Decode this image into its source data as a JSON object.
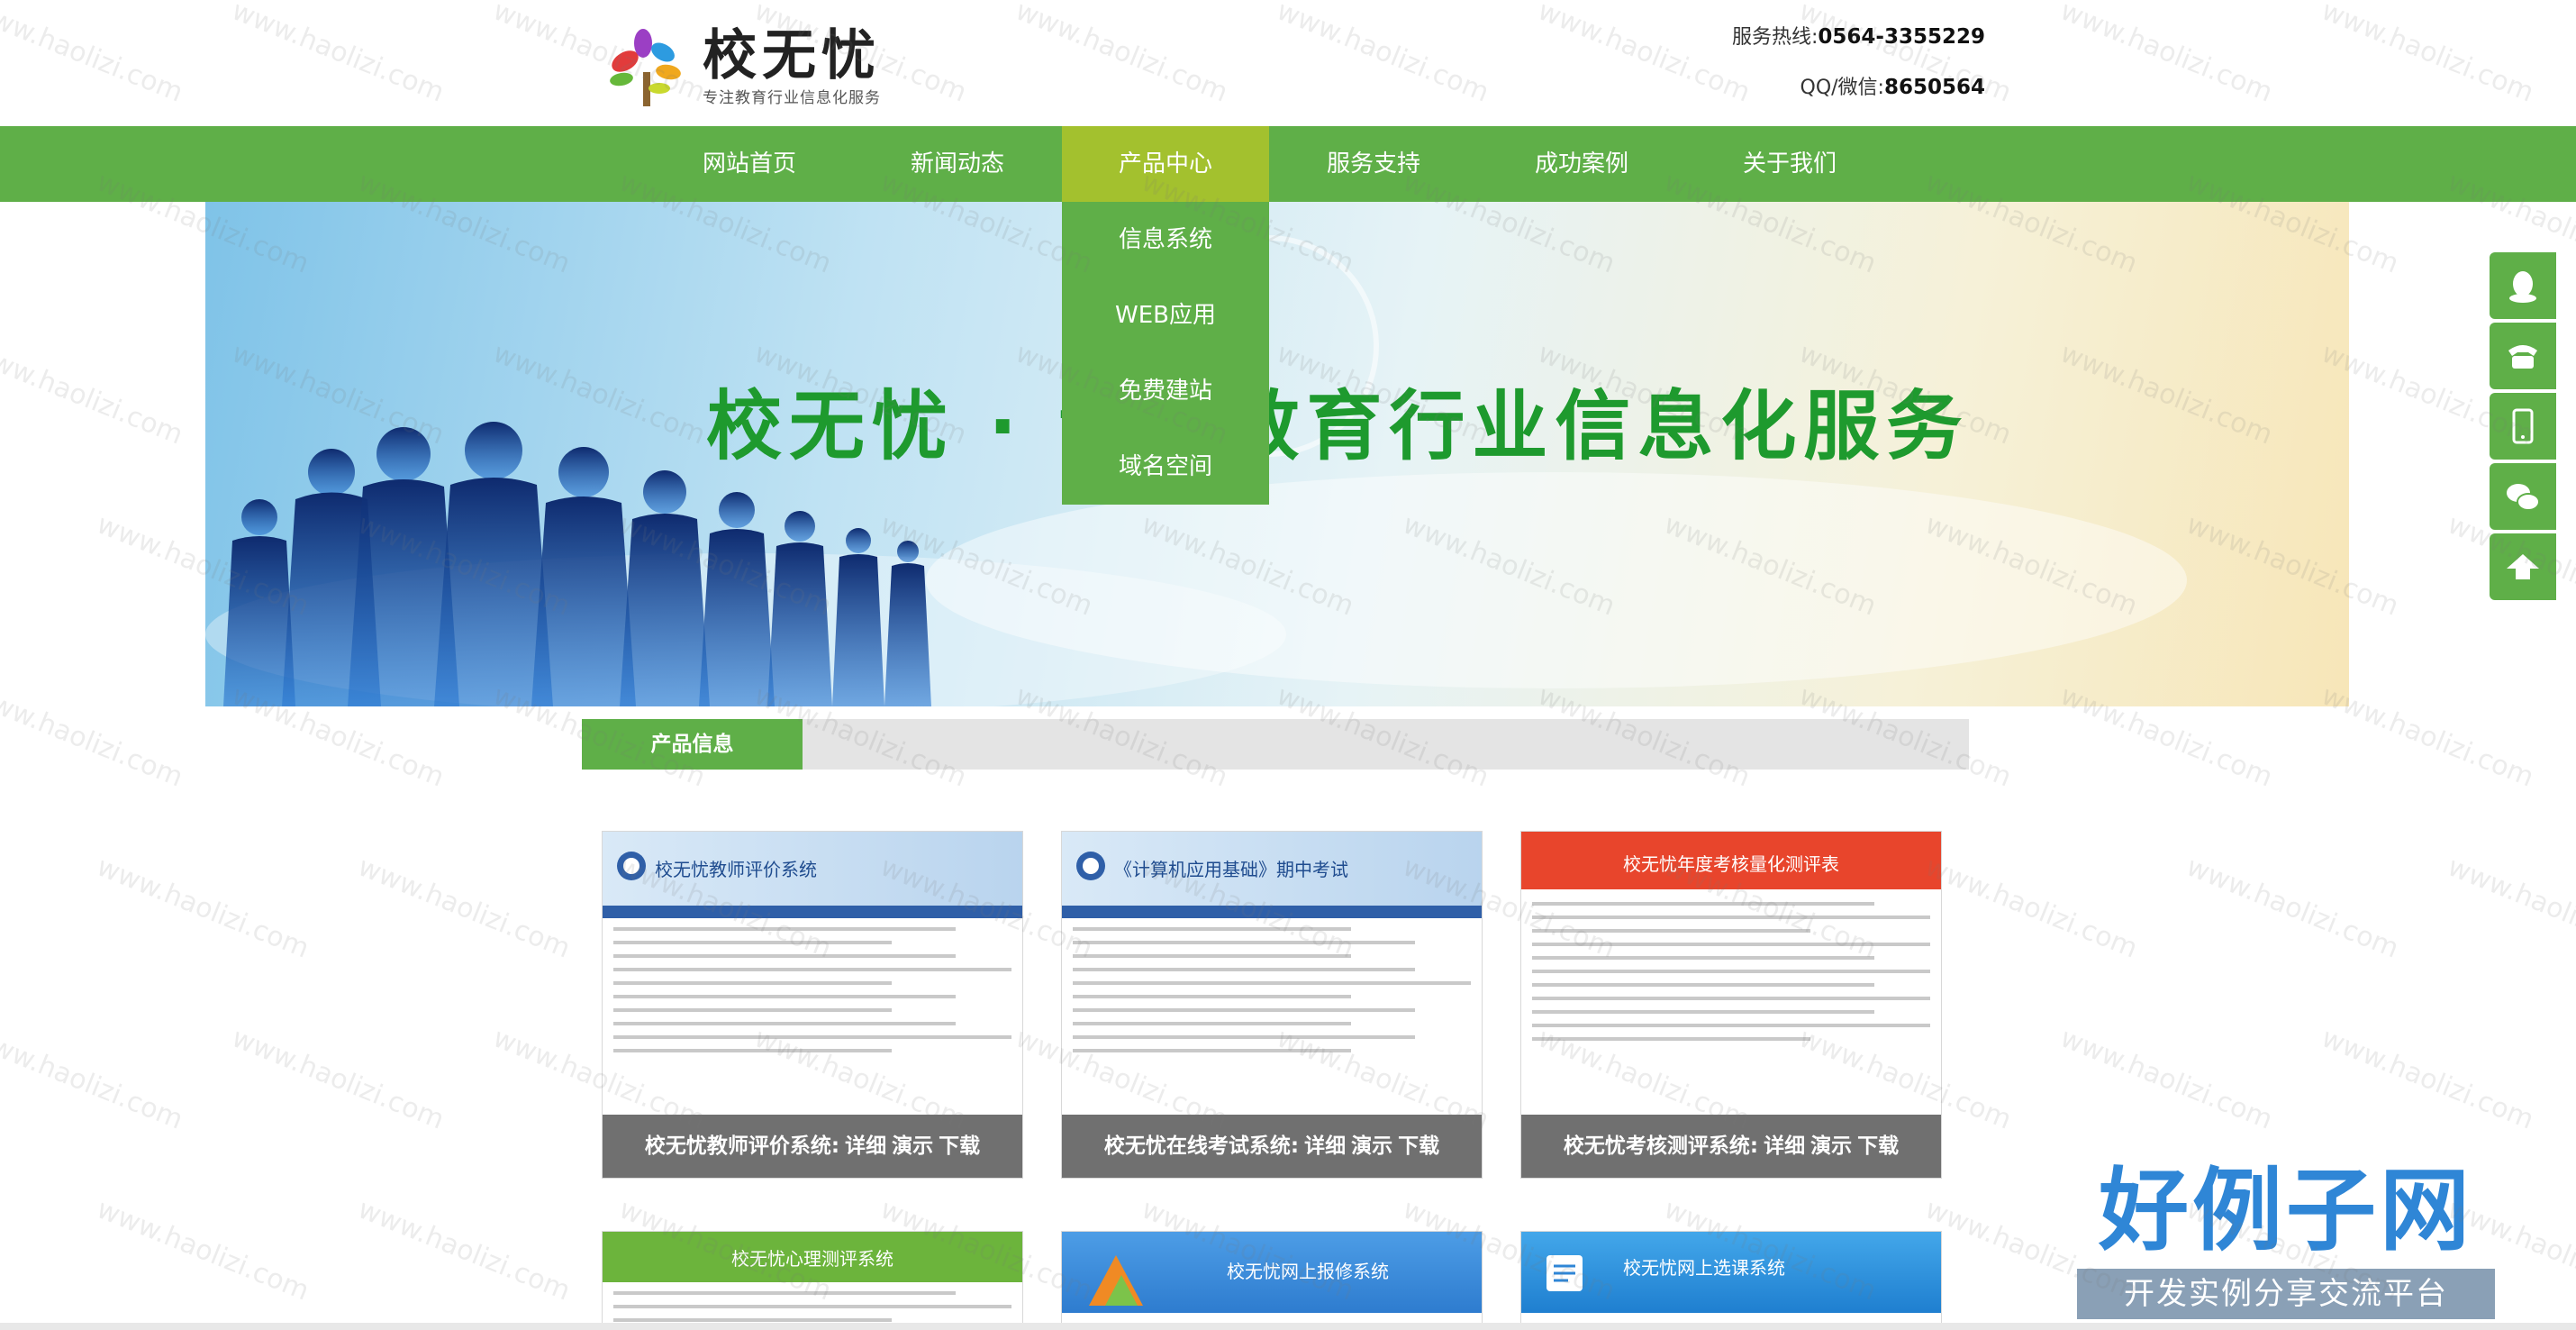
{
  "header": {
    "logo_title": "校无忧",
    "logo_slogan": "专注教育行业信息化服务",
    "hotline_label": "服务热线:",
    "hotline_value": "0564-3355229",
    "qq_label": "QQ/微信:",
    "qq_value": "8650564"
  },
  "nav": {
    "items": [
      {
        "label": "网站首页"
      },
      {
        "label": "新闻动态"
      },
      {
        "label": "产品中心"
      },
      {
        "label": "服务支持"
      },
      {
        "label": "成功案例"
      },
      {
        "label": "关于我们"
      }
    ],
    "active_index": 2,
    "dropdown": [
      {
        "label": "信息系统"
      },
      {
        "label": "WEB应用"
      },
      {
        "label": "免费建站"
      },
      {
        "label": "域名空间"
      }
    ]
  },
  "banner": {
    "slogan": "校无忧 · 专注教育行业信息化服务"
  },
  "section": {
    "title": "产品信息"
  },
  "products": [
    {
      "screen_title": "校无忧教师评价系统",
      "name": "校无忧教师评价系统:",
      "detail": "详细",
      "demo": "演示",
      "download": "下载"
    },
    {
      "screen_title": "《计算机应用基础》期中考试",
      "name": "校无忧在线考试系统:",
      "detail": "详细",
      "demo": "演示",
      "download": "下载"
    },
    {
      "screen_title": "校无忧年度考核量化测评表",
      "name": "校无忧考核测评系统:",
      "detail": "详细",
      "demo": "演示",
      "download": "下载"
    }
  ],
  "products_row2": [
    {
      "screen_title": "校无忧心理测评系统"
    },
    {
      "screen_title": "校无忧网上报修系统"
    },
    {
      "screen_title": "校无忧网上选课系统"
    }
  ],
  "brand": {
    "title": "好例子网",
    "subtitle": "开发实例分享交流平台"
  },
  "watermark_text": "www.haolizi.com",
  "colors": {
    "nav_green": "#5faf48",
    "nav_active": "#a3c12e",
    "caption_gray": "#707070",
    "slogan_green": "#1e9a2e"
  }
}
